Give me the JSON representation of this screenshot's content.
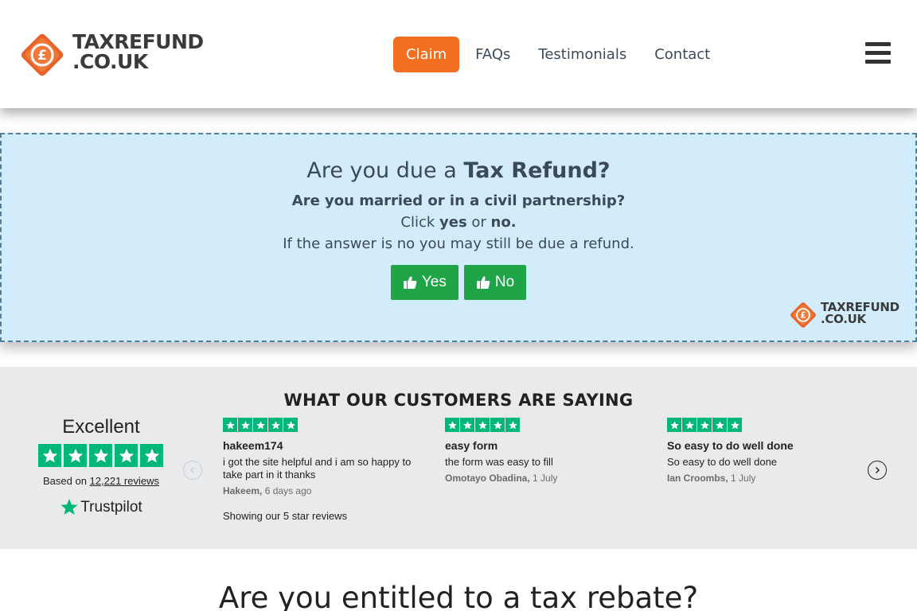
{
  "header": {
    "logo_line1": "TAXREFUND",
    "logo_line2": ".CO.UK",
    "nav": [
      {
        "label": "Claim"
      },
      {
        "label": "FAQs"
      },
      {
        "label": "Testimonials"
      },
      {
        "label": "Contact"
      }
    ]
  },
  "question": {
    "title_prefix": "Are you due a ",
    "title_bold": "Tax Refund?",
    "subtitle": "Are you married or in a civil partnership?",
    "click_prefix": "Click ",
    "click_yes": "yes",
    "click_or": " or ",
    "click_no": "no.",
    "note": "If the answer is no you may still be due a refund.",
    "yes_label": "Yes",
    "no_label": "No"
  },
  "reviews": {
    "heading": "WHAT OUR CUSTOMERS ARE SAYING",
    "summary": {
      "rating_text": "Excellent",
      "stars": 5,
      "based_prefix": "Based on ",
      "review_count": "12,221 reviews",
      "brand": "Trustpilot"
    },
    "items": [
      {
        "stars": 5,
        "title": "hakeem174",
        "text": "i got the site helpful and i am so happy to take part in it thanks",
        "author": "Hakeem,",
        "date": "6 days ago"
      },
      {
        "stars": 5,
        "title": "easy form",
        "text": "the form was easy to fill",
        "author": "Omotayo Obadina,",
        "date": "1 July"
      },
      {
        "stars": 5,
        "title": "So easy to do well done",
        "text": "So easy to do well done",
        "author": "Ian Croombs,",
        "date": "1 July"
      }
    ],
    "showing": "Showing our 5 star reviews"
  },
  "bottom": {
    "heading": "Are you entitled to a tax rebate?"
  },
  "colors": {
    "accent": "#f26f21",
    "panel": "#d2ecfb",
    "button_green": "#1fa447",
    "trustpilot_green": "#00b67a"
  }
}
